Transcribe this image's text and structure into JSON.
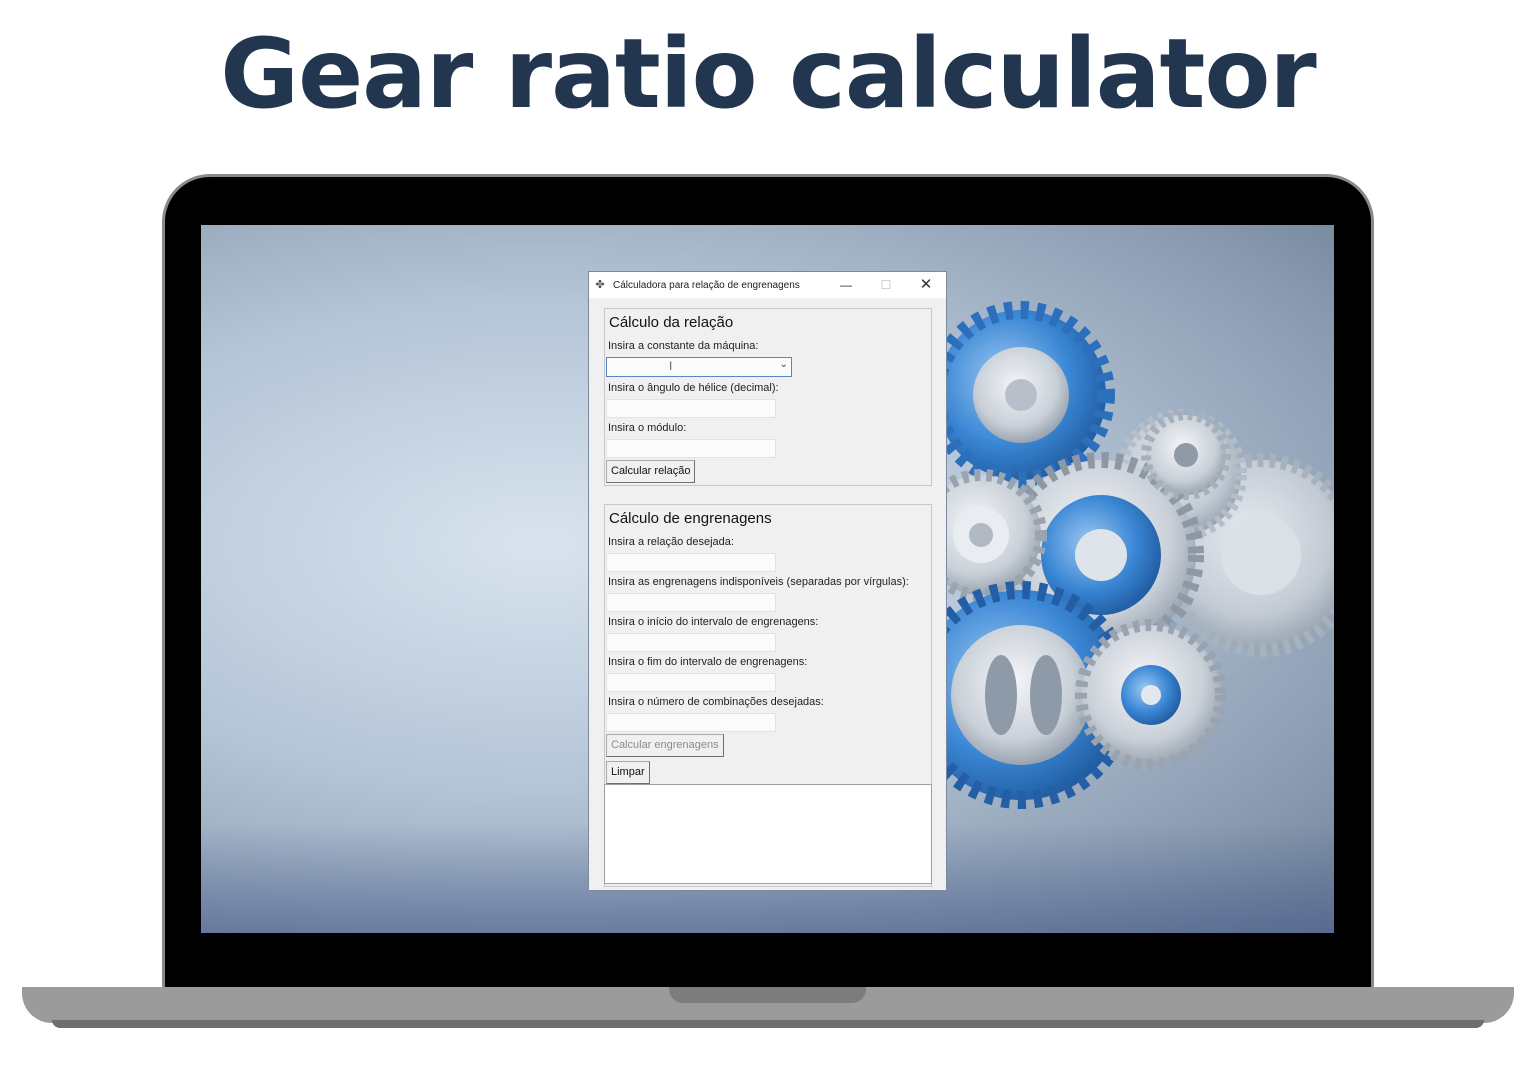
{
  "headline": "Gear ratio calculator",
  "window": {
    "title": "Cálculadora para relação de engrenagens",
    "controls": {
      "minimize": "—",
      "maximize": "☐",
      "close": "✕"
    }
  },
  "relacao": {
    "heading": "Cálculo da relação",
    "constante_label": "Insira a constante da máquina:",
    "constante_value": "",
    "angulo_label": "Insira o ângulo de hélice (decimal):",
    "modulo_label": "Insira o módulo:",
    "calcular_button": "Calcular relação"
  },
  "engrenagens": {
    "heading": "Cálculo de engrenagens",
    "relacao_label": "Insira a relação desejada:",
    "indisponiveis_label": "Insira as engrenagens indisponíveis (separadas por vírgulas):",
    "inicio_label": "Insira o início do intervalo de engrenagens:",
    "fim_label": "Insira o fim do intervalo de engrenagens:",
    "combinacoes_label": "Insira o número de combinações desejadas:",
    "calcular_button": "Calcular engrenagens",
    "limpar_button": "Limpar"
  },
  "colors": {
    "headline": "#233650",
    "accent_gear": "#2f7fd6",
    "window_bg": "#f0f0f0"
  }
}
